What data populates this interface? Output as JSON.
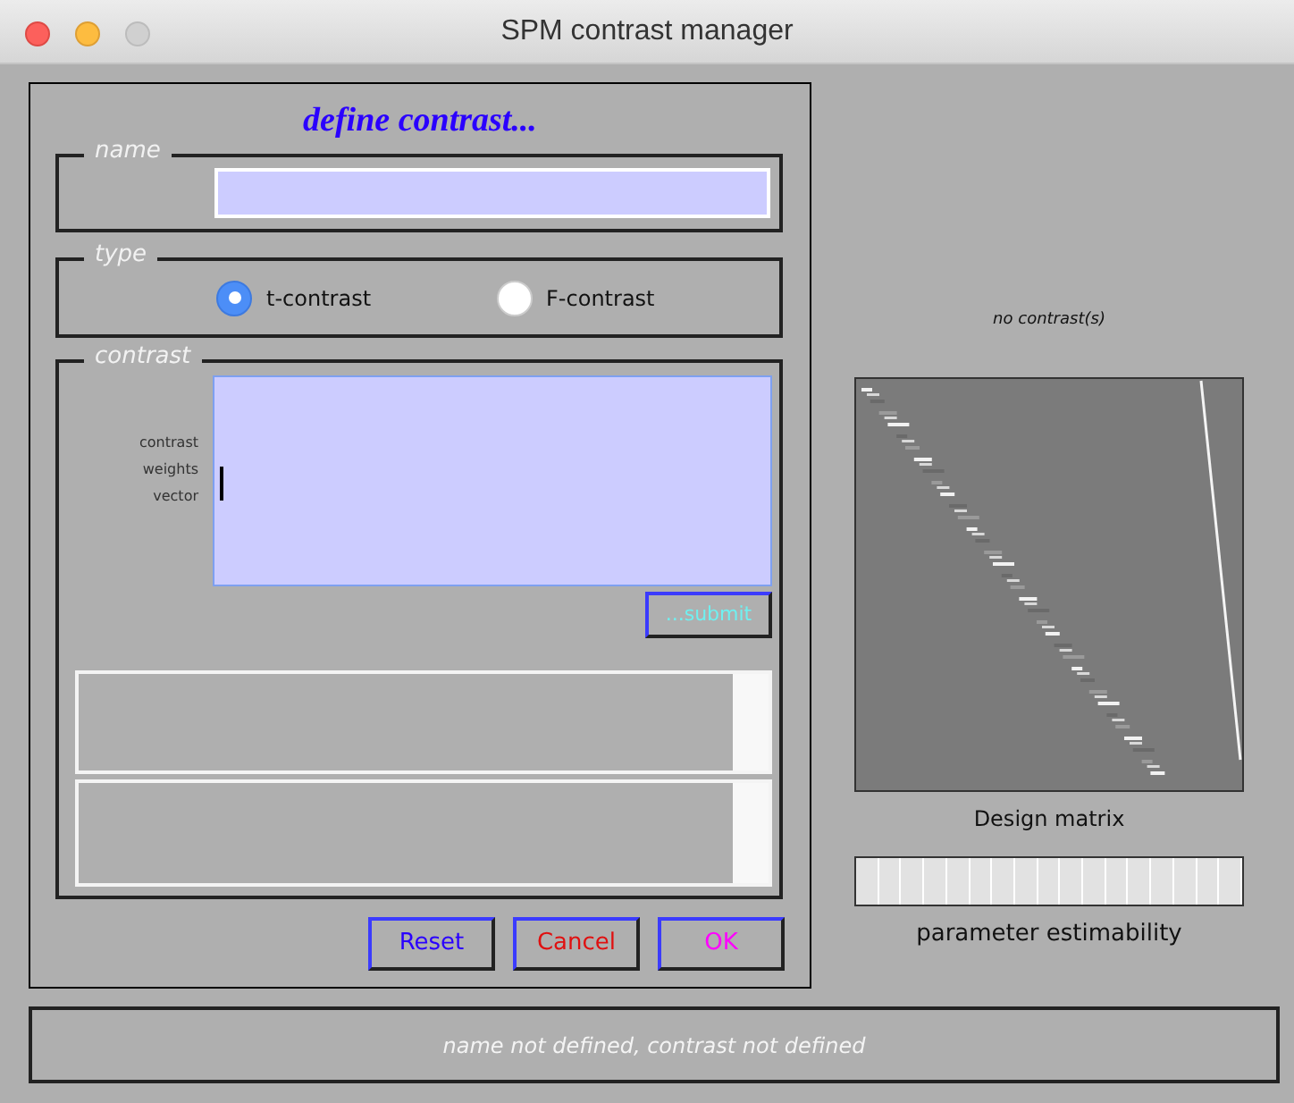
{
  "window": {
    "title": "SPM contrast manager"
  },
  "heading": "define contrast...",
  "name_group": {
    "legend": "name"
  },
  "type_group": {
    "legend": "type",
    "options": [
      {
        "label": "t-contrast",
        "selected": true
      },
      {
        "label": "F-contrast",
        "selected": false
      }
    ]
  },
  "contrast_group": {
    "legend": "contrast",
    "field_label": [
      "contrast",
      "weights",
      "vector"
    ],
    "submit": "...submit"
  },
  "buttons": [
    {
      "label": "Reset",
      "color": "#2a00ff"
    },
    {
      "label": "Cancel",
      "color": "#e01010"
    },
    {
      "label": "OK",
      "color": "#ff00ff"
    }
  ],
  "design": {
    "caption": "no contrast(s)",
    "matrix_label": "Design matrix",
    "estimability_label": "parameter estimability"
  },
  "status": "name not defined, contrast not defined"
}
